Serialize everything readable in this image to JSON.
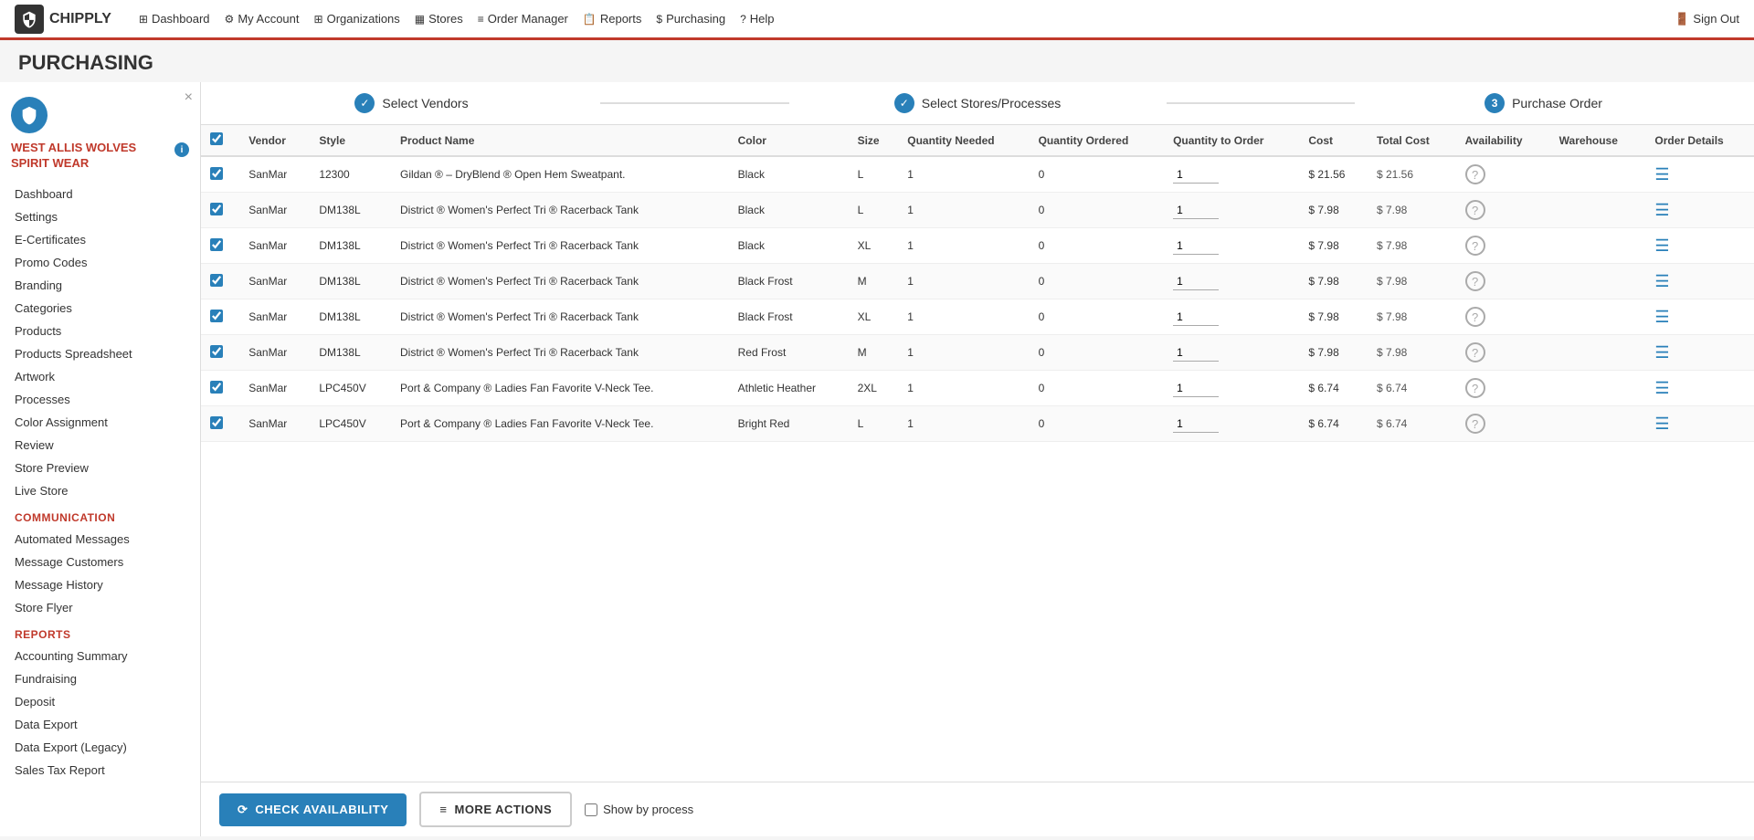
{
  "app": {
    "logo_text": "CHIPPLY",
    "logo_icon": "🛡"
  },
  "nav": {
    "items": [
      {
        "label": "Dashboard",
        "icon": "⊞"
      },
      {
        "label": "My Account",
        "icon": "⚙"
      },
      {
        "label": "Organizations",
        "icon": "⊞"
      },
      {
        "label": "Stores",
        "icon": "▦"
      },
      {
        "label": "Order Manager",
        "icon": "≡"
      },
      {
        "label": "Reports",
        "icon": "📋"
      },
      {
        "label": "Purchasing",
        "icon": "$"
      },
      {
        "label": "Help",
        "icon": "?"
      }
    ],
    "sign_out": "Sign Out",
    "sign_out_icon": "🚪"
  },
  "page": {
    "title": "PURCHASING"
  },
  "sidebar": {
    "org_name": "WEST ALLIS WOLVES SPIRIT WEAR",
    "close_icon": "×",
    "sections": [
      {
        "items": [
          {
            "label": "Dashboard"
          },
          {
            "label": "Settings"
          },
          {
            "label": "E-Certificates"
          },
          {
            "label": "Promo Codes"
          },
          {
            "label": "Branding"
          },
          {
            "label": "Categories"
          },
          {
            "label": "Products"
          },
          {
            "label": "Products Spreadsheet"
          },
          {
            "label": "Artwork"
          },
          {
            "label": "Processes"
          },
          {
            "label": "Color Assignment"
          },
          {
            "label": "Review"
          },
          {
            "label": "Store Preview"
          },
          {
            "label": "Live Store"
          }
        ]
      },
      {
        "section_label": "COMMUNICATION",
        "items": [
          {
            "label": "Automated Messages"
          },
          {
            "label": "Message Customers"
          },
          {
            "label": "Message History"
          },
          {
            "label": "Store Flyer"
          }
        ]
      },
      {
        "section_label": "REPORTS",
        "items": [
          {
            "label": "Accounting Summary"
          },
          {
            "label": "Fundraising"
          },
          {
            "label": "Deposit"
          },
          {
            "label": "Data Export"
          },
          {
            "label": "Data Export (Legacy)"
          },
          {
            "label": "Sales Tax Report"
          }
        ]
      }
    ]
  },
  "stepper": {
    "steps": [
      {
        "type": "check",
        "label": "Select Vendors"
      },
      {
        "type": "check",
        "label": "Select Stores/Processes"
      },
      {
        "type": "number",
        "num": "3",
        "label": "Purchase Order"
      }
    ]
  },
  "table": {
    "headers": [
      "",
      "Vendor",
      "Style",
      "Product Name",
      "Color",
      "Size",
      "Quantity Needed",
      "Quantity Ordered",
      "Quantity to Order",
      "Cost",
      "Total Cost",
      "Availability",
      "Warehouse",
      "Order Details"
    ],
    "rows": [
      {
        "checked": true,
        "vendor": "SanMar",
        "style": "12300",
        "product": "Gildan ® – DryBlend ® Open Hem Sweatpant.",
        "color": "Black",
        "size": "L",
        "qty_needed": 1,
        "qty_ordered": 0,
        "qty_to_order": 1,
        "cost": "$ 21.56",
        "total_cost": "$ 21.56"
      },
      {
        "checked": true,
        "vendor": "SanMar",
        "style": "DM138L",
        "product": "District ® Women's Perfect Tri ® Racerback Tank",
        "color": "Black",
        "size": "L",
        "qty_needed": 1,
        "qty_ordered": 0,
        "qty_to_order": 1,
        "cost": "$ 7.98",
        "total_cost": "$ 7.98"
      },
      {
        "checked": true,
        "vendor": "SanMar",
        "style": "DM138L",
        "product": "District ® Women's Perfect Tri ® Racerback Tank",
        "color": "Black",
        "size": "XL",
        "qty_needed": 1,
        "qty_ordered": 0,
        "qty_to_order": 1,
        "cost": "$ 7.98",
        "total_cost": "$ 7.98"
      },
      {
        "checked": true,
        "vendor": "SanMar",
        "style": "DM138L",
        "product": "District ® Women's Perfect Tri ® Racerback Tank",
        "color": "Black Frost",
        "size": "M",
        "qty_needed": 1,
        "qty_ordered": 0,
        "qty_to_order": 1,
        "cost": "$ 7.98",
        "total_cost": "$ 7.98"
      },
      {
        "checked": true,
        "vendor": "SanMar",
        "style": "DM138L",
        "product": "District ® Women's Perfect Tri ® Racerback Tank",
        "color": "Black Frost",
        "size": "XL",
        "qty_needed": 1,
        "qty_ordered": 0,
        "qty_to_order": 1,
        "cost": "$ 7.98",
        "total_cost": "$ 7.98"
      },
      {
        "checked": true,
        "vendor": "SanMar",
        "style": "DM138L",
        "product": "District ® Women's Perfect Tri ® Racerback Tank",
        "color": "Red Frost",
        "size": "M",
        "qty_needed": 1,
        "qty_ordered": 0,
        "qty_to_order": 1,
        "cost": "$ 7.98",
        "total_cost": "$ 7.98"
      },
      {
        "checked": true,
        "vendor": "SanMar",
        "style": "LPC450V",
        "product": "Port & Company ® Ladies Fan Favorite V-Neck Tee.",
        "color": "Athletic Heather",
        "size": "2XL",
        "qty_needed": 1,
        "qty_ordered": 0,
        "qty_to_order": 1,
        "cost": "$ 6.74",
        "total_cost": "$ 6.74"
      },
      {
        "checked": true,
        "vendor": "SanMar",
        "style": "LPC450V",
        "product": "Port & Company ® Ladies Fan Favorite V-Neck Tee.",
        "color": "Bright Red",
        "size": "L",
        "qty_needed": 1,
        "qty_ordered": 0,
        "qty_to_order": 1,
        "cost": "$ 6.74",
        "total_cost": "$ 6.74"
      }
    ]
  },
  "bottom": {
    "check_availability_label": "CHECK AVAILABILITY",
    "more_actions_label": "MORE ACTIONS",
    "show_by_process_label": "Show by process",
    "check_icon": "✓",
    "list_icon": "≡"
  }
}
